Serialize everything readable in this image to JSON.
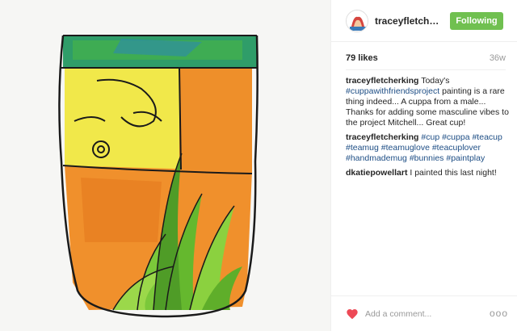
{
  "post": {
    "username": "traceyfletcherki...",
    "follow_label": "Following",
    "likes": "79 likes",
    "age": "36w",
    "comments": [
      {
        "user": "traceyfletcherking",
        "parts": [
          {
            "t": " Today's ",
            "tag": false
          },
          {
            "t": "#cuppawithfriendsproject",
            "tag": true
          },
          {
            "t": " painting is a rare thing indeed... A cuppa from a male... Thanks for adding some masculine vibes to the project Mitchell... Great cup!",
            "tag": false
          }
        ]
      },
      {
        "user": "traceyfletcherking",
        "parts": [
          {
            "t": " ",
            "tag": false
          },
          {
            "t": "#cup",
            "tag": true
          },
          {
            "t": " ",
            "tag": false
          },
          {
            "t": "#cuppa",
            "tag": true
          },
          {
            "t": " ",
            "tag": false
          },
          {
            "t": "#teacup",
            "tag": true
          },
          {
            "t": " ",
            "tag": false
          },
          {
            "t": "#teamug",
            "tag": true
          },
          {
            "t": " ",
            "tag": false
          },
          {
            "t": "#teamuglove",
            "tag": true
          },
          {
            "t": " ",
            "tag": false
          },
          {
            "t": "#teacuplover",
            "tag": true
          },
          {
            "t": " ",
            "tag": false
          },
          {
            "t": "#handmademug",
            "tag": true
          },
          {
            "t": " ",
            "tag": false
          },
          {
            "t": "#bunnies",
            "tag": true
          },
          {
            "t": " ",
            "tag": false
          },
          {
            "t": "#paintplay",
            "tag": true
          }
        ]
      },
      {
        "user": "dkatiepowellart",
        "parts": [
          {
            "t": " I painted this last night!",
            "tag": false
          }
        ]
      }
    ],
    "add_comment_placeholder": "Add a comment...",
    "more_label": "ooo"
  },
  "icons": {
    "heart": "heart-icon",
    "more": "more-options-icon",
    "avatar": "avatar"
  },
  "colors": {
    "follow_button": "#70c050",
    "heart": "#ed4956",
    "hashtag": "#1e4e85"
  }
}
